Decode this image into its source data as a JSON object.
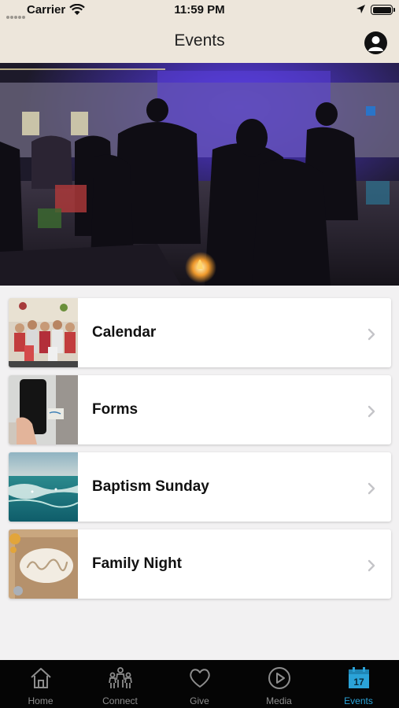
{
  "status_bar": {
    "carrier": "Carrier",
    "time": "11:59 PM"
  },
  "nav": {
    "title": "Events",
    "profile_icon": "person-icon"
  },
  "hero": {
    "description_icon": "photo"
  },
  "cards": [
    {
      "label": "Calendar",
      "thumb": "family-photo"
    },
    {
      "label": "Forms",
      "thumb": "phone-photo"
    },
    {
      "label": "Baptism Sunday",
      "thumb": "ocean-photo"
    },
    {
      "label": "Family Night",
      "thumb": "flour-family-photo"
    }
  ],
  "tabs": [
    {
      "label": "Home",
      "icon": "house-icon"
    },
    {
      "label": "Connect",
      "icon": "people-icon"
    },
    {
      "label": "Give",
      "icon": "heart-icon"
    },
    {
      "label": "Media",
      "icon": "play-icon"
    },
    {
      "label": "Events",
      "icon": "calendar-icon",
      "badge": "17"
    }
  ],
  "colors": {
    "topbar": "#ede6db",
    "tab_active": "#2ba3d8",
    "tab_inactive": "#8d8d8d",
    "tabbar_bg": "#050505"
  }
}
